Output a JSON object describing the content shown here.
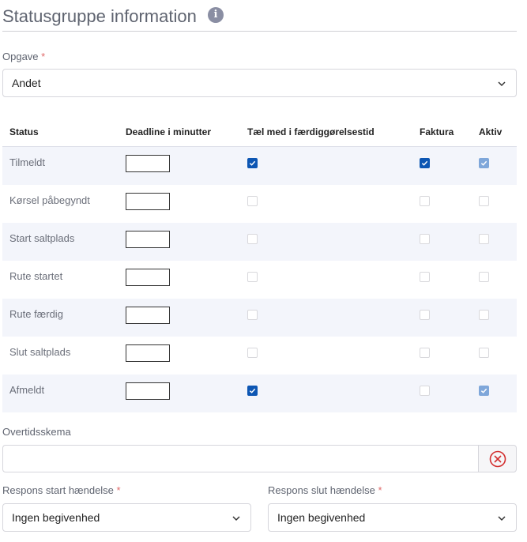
{
  "header": {
    "title": "Statusgruppe information",
    "info_icon": "info-icon"
  },
  "task": {
    "label": "Opgave",
    "required_mark": "*",
    "value": "Andet"
  },
  "table": {
    "headers": [
      "Status",
      "Deadline i minutter",
      "Tæl med i færdiggørelsestid",
      "Faktura",
      "Aktiv"
    ],
    "rows": [
      {
        "status": "Tilmeldt",
        "deadline": "",
        "count": "checked",
        "invoice": "checked",
        "active": "checked-disabled"
      },
      {
        "status": "Kørsel påbegyndt",
        "deadline": "",
        "count": "unchecked",
        "invoice": "unchecked",
        "active": "unchecked"
      },
      {
        "status": "Start saltplads",
        "deadline": "",
        "count": "unchecked",
        "invoice": "unchecked",
        "active": "unchecked"
      },
      {
        "status": "Rute startet",
        "deadline": "",
        "count": "unchecked",
        "invoice": "unchecked",
        "active": "unchecked"
      },
      {
        "status": "Rute færdig",
        "deadline": "",
        "count": "unchecked",
        "invoice": "unchecked",
        "active": "unchecked"
      },
      {
        "status": "Slut saltplads",
        "deadline": "",
        "count": "unchecked",
        "invoice": "unchecked",
        "active": "unchecked"
      },
      {
        "status": "Afmeldt",
        "deadline": "",
        "count": "checked",
        "invoice": "unchecked",
        "active": "checked-disabled"
      }
    ]
  },
  "overtime": {
    "label": "Overtidsskema",
    "value": "",
    "clear_icon": "close-circle-icon"
  },
  "response_start": {
    "label": "Respons start hændelse",
    "required_mark": "*",
    "value": "Ingen begivenhed"
  },
  "response_end": {
    "label": "Respons slut hændelse",
    "required_mark": "*",
    "value": "Ingen begivenhed"
  },
  "colors": {
    "accent": "#0d56b3",
    "accent_disabled": "#7fa7da",
    "row_shade": "#f3f5fb",
    "required": "#e06a6a",
    "clear_icon": "#d32f2f"
  }
}
